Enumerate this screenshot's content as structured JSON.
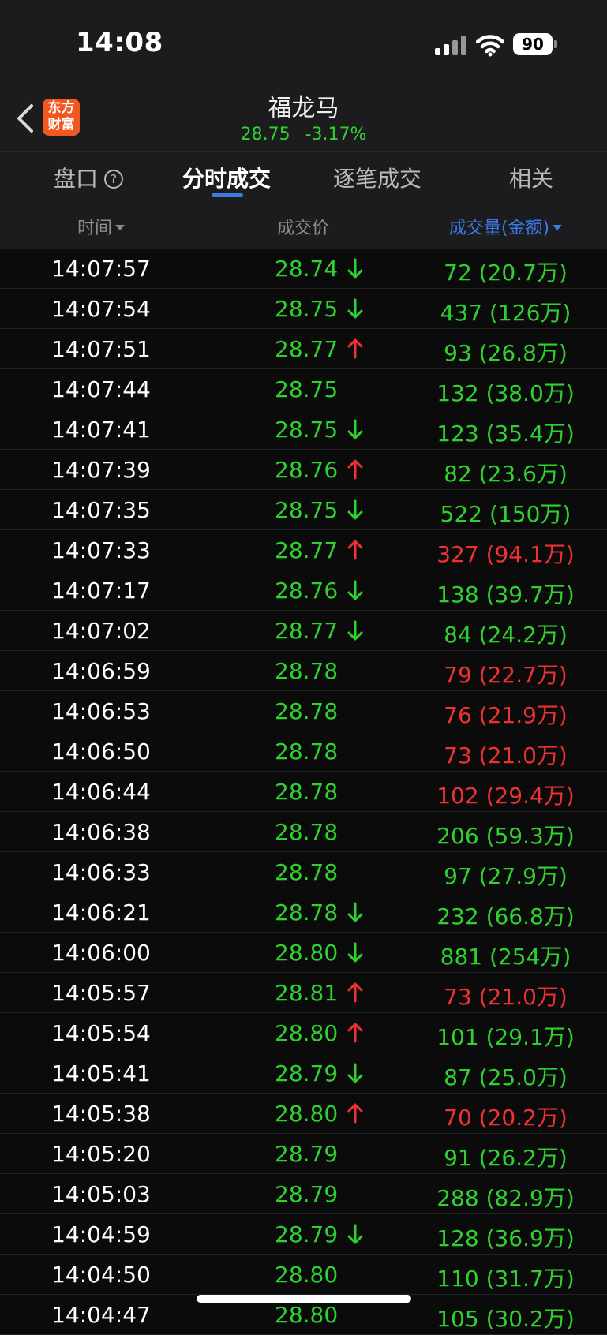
{
  "status_bar": {
    "time": "14:08",
    "battery": "90"
  },
  "header": {
    "logo_text": "东方财富",
    "stock_name": "福龙马",
    "price": "28.75",
    "change_pct": "-3.17%"
  },
  "tabs": [
    {
      "label": "盘口",
      "active": false
    },
    {
      "label": "分时成交",
      "active": true
    },
    {
      "label": "逐笔成交",
      "active": false
    },
    {
      "label": "相关",
      "active": false
    }
  ],
  "columns": {
    "time": "时间",
    "price": "成交价",
    "volume": "成交量(金额)"
  },
  "colors": {
    "up": "#ee3131",
    "down": "#2fd12f",
    "accent": "#3b7be8",
    "brand": "#f2571f"
  },
  "trades": [
    {
      "time": "14:07:57",
      "price": "28.74",
      "dir": "down",
      "vol": "72 (20.7万)",
      "vol_color": "green"
    },
    {
      "time": "14:07:54",
      "price": "28.75",
      "dir": "down",
      "vol": "437 (126万)",
      "vol_color": "green"
    },
    {
      "time": "14:07:51",
      "price": "28.77",
      "dir": "up",
      "vol": "93 (26.8万)",
      "vol_color": "green"
    },
    {
      "time": "14:07:44",
      "price": "28.75",
      "dir": "",
      "vol": "132 (38.0万)",
      "vol_color": "green"
    },
    {
      "time": "14:07:41",
      "price": "28.75",
      "dir": "down",
      "vol": "123 (35.4万)",
      "vol_color": "green"
    },
    {
      "time": "14:07:39",
      "price": "28.76",
      "dir": "up",
      "vol": "82 (23.6万)",
      "vol_color": "green"
    },
    {
      "time": "14:07:35",
      "price": "28.75",
      "dir": "down",
      "vol": "522 (150万)",
      "vol_color": "green"
    },
    {
      "time": "14:07:33",
      "price": "28.77",
      "dir": "up",
      "vol": "327 (94.1万)",
      "vol_color": "red"
    },
    {
      "time": "14:07:17",
      "price": "28.76",
      "dir": "down",
      "vol": "138 (39.7万)",
      "vol_color": "green"
    },
    {
      "time": "14:07:02",
      "price": "28.77",
      "dir": "down",
      "vol": "84 (24.2万)",
      "vol_color": "green"
    },
    {
      "time": "14:06:59",
      "price": "28.78",
      "dir": "",
      "vol": "79 (22.7万)",
      "vol_color": "red"
    },
    {
      "time": "14:06:53",
      "price": "28.78",
      "dir": "",
      "vol": "76 (21.9万)",
      "vol_color": "red"
    },
    {
      "time": "14:06:50",
      "price": "28.78",
      "dir": "",
      "vol": "73 (21.0万)",
      "vol_color": "red"
    },
    {
      "time": "14:06:44",
      "price": "28.78",
      "dir": "",
      "vol": "102 (29.4万)",
      "vol_color": "red"
    },
    {
      "time": "14:06:38",
      "price": "28.78",
      "dir": "",
      "vol": "206 (59.3万)",
      "vol_color": "green"
    },
    {
      "time": "14:06:33",
      "price": "28.78",
      "dir": "",
      "vol": "97 (27.9万)",
      "vol_color": "green"
    },
    {
      "time": "14:06:21",
      "price": "28.78",
      "dir": "down",
      "vol": "232 (66.8万)",
      "vol_color": "green"
    },
    {
      "time": "14:06:00",
      "price": "28.80",
      "dir": "down",
      "vol": "881 (254万)",
      "vol_color": "green"
    },
    {
      "time": "14:05:57",
      "price": "28.81",
      "dir": "up",
      "vol": "73 (21.0万)",
      "vol_color": "red"
    },
    {
      "time": "14:05:54",
      "price": "28.80",
      "dir": "up",
      "vol": "101 (29.1万)",
      "vol_color": "green"
    },
    {
      "time": "14:05:41",
      "price": "28.79",
      "dir": "down",
      "vol": "87 (25.0万)",
      "vol_color": "green"
    },
    {
      "time": "14:05:38",
      "price": "28.80",
      "dir": "up",
      "vol": "70 (20.2万)",
      "vol_color": "red"
    },
    {
      "time": "14:05:20",
      "price": "28.79",
      "dir": "",
      "vol": "91 (26.2万)",
      "vol_color": "green"
    },
    {
      "time": "14:05:03",
      "price": "28.79",
      "dir": "",
      "vol": "288 (82.9万)",
      "vol_color": "green"
    },
    {
      "time": "14:04:59",
      "price": "28.79",
      "dir": "down",
      "vol": "128 (36.9万)",
      "vol_color": "green"
    },
    {
      "time": "14:04:50",
      "price": "28.80",
      "dir": "",
      "vol": "110 (31.7万)",
      "vol_color": "green"
    },
    {
      "time": "14:04:47",
      "price": "28.80",
      "dir": "",
      "vol": "105 (30.2万)",
      "vol_color": "green"
    }
  ]
}
